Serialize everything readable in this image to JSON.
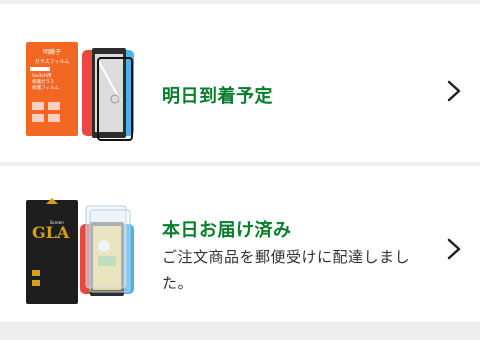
{
  "orders": [
    {
      "product": "screen protector glass film (orange box)",
      "status": "明日到着予定",
      "description": "",
      "thumb_text": [
        "明鏡子",
        "ガラスフィルム",
        "Switch用",
        "保護ガラス",
        "保護フィルム"
      ]
    },
    {
      "product": "screen protector glass (black box)",
      "status": "本日お届け済み",
      "description": "ご注文商品を郵便受けに配達しました。",
      "thumb_text": [
        "GLA",
        "Screen"
      ]
    }
  ],
  "colors": {
    "status_green": "#067d2b",
    "separator": "#eeeeee"
  },
  "icons": {
    "chevron": "chevron-right-icon"
  }
}
